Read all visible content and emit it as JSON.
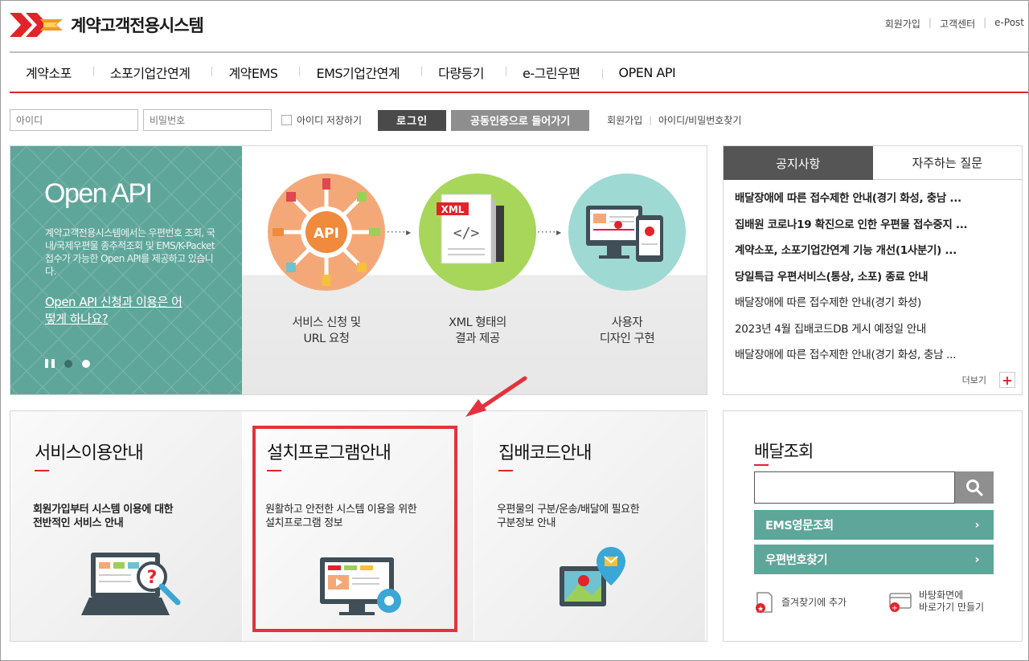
{
  "header": {
    "site_name": "계약고객전용시스템",
    "util_links": [
      "회원가입",
      "고객센터",
      "e-Post"
    ]
  },
  "nav": [
    "계약소포",
    "소포기업간연계",
    "계약EMS",
    "EMS기업간연계",
    "다량등기",
    "e-그린우편",
    "OPEN API"
  ],
  "login": {
    "id_placeholder": "아이디",
    "pw_placeholder": "비밀번호",
    "remember_label": "아이디 저장하기",
    "login_button": "로그인",
    "cert_button": "공동인증으로 들어가기",
    "join_link": "회원가입",
    "find_link": "아이디/비밀번호찾기"
  },
  "banner": {
    "title": "Open API",
    "description": "계약고객전용시스템에서는 우편번호 조회, 국내/국제우편물 종추적조회 및 EMS/K-Packet 접수가 가능한 Open API를 제공하고 있습니다.",
    "link": "Open API 신청과 이용은 어떻게 하나요?",
    "api_label": "API",
    "xml_label": "XML",
    "steps": [
      "서비스 신청 및\nURL 요청",
      "XML 형태의\n결과 제공",
      "사용자\n디자인 구현"
    ]
  },
  "notice": {
    "tab_active": "공지사항",
    "tab_inactive": "자주하는 질문",
    "items": [
      "배달장애에 따른 접수제한 안내(경기 화성, 충남 ...",
      "집배원 코로나19 확진으로 인한 우편물 접수중지 ...",
      "계약소포, 소포기업간연계 기능 개선(1사분기)  ...",
      "당일특급 우편서비스(통상, 소포) 종료 안내",
      "배달장애에 따른 접수제한 안내(경기 화성)",
      "2023년 4월 집배코드DB 게시 예정일 안내",
      "배달장애에 따른 접수제한 안내(경기 화성, 충남 ..."
    ],
    "more_label": "더보기"
  },
  "guides": [
    {
      "title": "서비스이용안내",
      "desc": "회원가입부터 시스템 이용에 대한\n전반적인 서비스 안내"
    },
    {
      "title": "설치프로그램안내",
      "desc": "원활하고 안전한 시스템 이용을 위한\n설치프로그램 정보"
    },
    {
      "title": "집배코드안내",
      "desc": "우편물의 구분/운송/배달에 필요한\n구분정보 안내"
    }
  ],
  "delivery": {
    "title": "배달조회",
    "ems_button": "EMS영문조회",
    "zip_button": "우편번호찾기",
    "bookmark_label": "즐겨찾기에 추가",
    "shortcut_label": "바탕화면에\n바로가기 만들기"
  },
  "colors": {
    "accent_red": "#e2232a",
    "teal": "#5fa69a",
    "dark_tab": "#555555"
  }
}
